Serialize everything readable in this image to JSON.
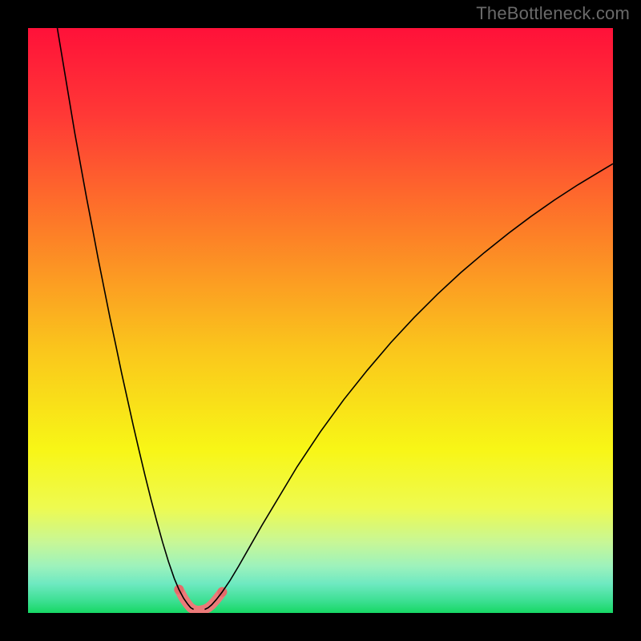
{
  "watermark": "TheBottleneck.com",
  "chart_data": {
    "type": "line",
    "title": "",
    "xlabel": "",
    "ylabel": "",
    "xlim": [
      0,
      100
    ],
    "ylim": [
      0,
      100
    ],
    "background": {
      "type": "vertical-gradient",
      "stops": [
        {
          "offset": 0,
          "color": "#ff1139"
        },
        {
          "offset": 15,
          "color": "#ff3936"
        },
        {
          "offset": 35,
          "color": "#fd7f27"
        },
        {
          "offset": 55,
          "color": "#fac61c"
        },
        {
          "offset": 72,
          "color": "#f8f616"
        },
        {
          "offset": 82,
          "color": "#eefa50"
        },
        {
          "offset": 88,
          "color": "#c7f797"
        },
        {
          "offset": 92,
          "color": "#9df2bc"
        },
        {
          "offset": 95,
          "color": "#6ee9c1"
        },
        {
          "offset": 98,
          "color": "#3bdf91"
        },
        {
          "offset": 100,
          "color": "#16d864"
        }
      ]
    },
    "valley_x": 29,
    "curve_left": {
      "name": "left-branch",
      "color": "#000000",
      "width": 1.6,
      "x": [
        5,
        6,
        7,
        8,
        9,
        10,
        11,
        12,
        13,
        14,
        15,
        16,
        17,
        18,
        19,
        20,
        21,
        22,
        23,
        24,
        25,
        25.8,
        26.6,
        27.3,
        27.8,
        28.3
      ],
      "y": [
        100,
        94,
        88,
        82,
        76.5,
        71,
        65.8,
        60.5,
        55.5,
        50.5,
        45.8,
        41,
        36.5,
        32,
        27.7,
        23.5,
        19.5,
        15.7,
        12.1,
        8.8,
        5.9,
        4.0,
        2.5,
        1.5,
        0.9,
        0.6
      ]
    },
    "curve_right": {
      "name": "right-branch",
      "color": "#000000",
      "width": 1.6,
      "x": [
        30.2,
        30.8,
        31.4,
        32.2,
        33.2,
        34.5,
        36,
        38,
        40,
        43,
        46,
        50,
        54,
        58,
        62,
        66,
        70,
        74,
        78,
        82,
        86,
        90,
        94,
        98,
        100
      ],
      "y": [
        0.6,
        0.9,
        1.4,
        2.3,
        3.6,
        5.5,
        8.0,
        11.5,
        15.0,
        20.0,
        25.0,
        31.0,
        36.5,
        41.5,
        46.2,
        50.5,
        54.5,
        58.2,
        61.6,
        64.8,
        67.8,
        70.6,
        73.2,
        75.6,
        76.8
      ]
    },
    "bottom_arc": {
      "name": "valley-marker",
      "color": "#ec7a79",
      "width": 12,
      "linecap": "round",
      "x": [
        25.8,
        26.6,
        27.3,
        27.8,
        28.3,
        28.7,
        29.0,
        29.5,
        30.2,
        30.8,
        31.4,
        32.2,
        33.2
      ],
      "y": [
        4.0,
        2.5,
        1.5,
        0.9,
        0.6,
        0.45,
        0.4,
        0.45,
        0.6,
        0.9,
        1.4,
        2.3,
        3.6
      ]
    },
    "markers": {
      "color": "#e56b6a",
      "radius": 6,
      "points": [
        {
          "x": 25.8,
          "y": 4.0
        },
        {
          "x": 33.2,
          "y": 3.6
        }
      ]
    }
  }
}
